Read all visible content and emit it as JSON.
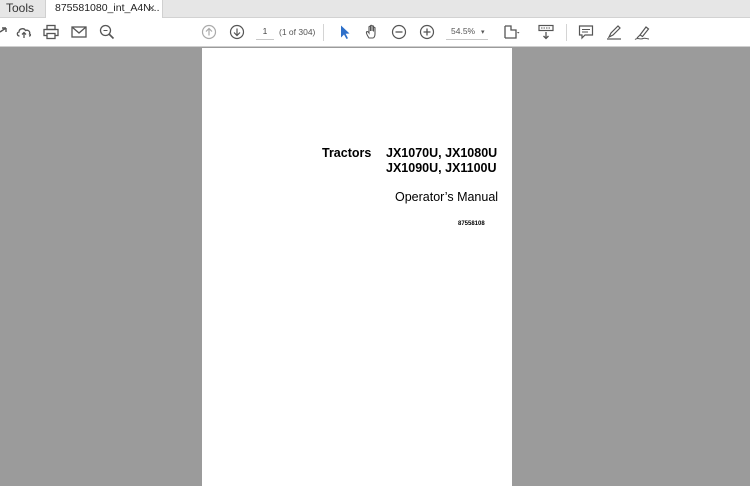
{
  "tabs": {
    "tools_label": "Tools",
    "doc_label": "875581080_int_A4N...",
    "close_glyph": "×"
  },
  "toolbar": {
    "icons": [
      "share-arrow-icon",
      "upload-cloud-icon",
      "print-icon",
      "email-icon",
      "search-icon",
      "page-up-icon",
      "page-down-icon",
      "select-cursor-icon",
      "hand-pan-icon",
      "zoom-out-icon",
      "zoom-in-icon",
      "fit-page-icon",
      "scroll-mode-icon",
      "comment-icon",
      "highlight-pen-icon",
      "sign-pen-icon"
    ],
    "page_current": "1",
    "page_of": "(1 of 304)",
    "zoom_value": "54.5%",
    "zoom_caret": "▾"
  },
  "document": {
    "title_left": "Tractors",
    "models_line1": "JX1070U, JX1080U",
    "models_line2": "JX1090U, JX1100U",
    "subtitle": "Operator’s Manual",
    "doc_number": "87558108"
  }
}
